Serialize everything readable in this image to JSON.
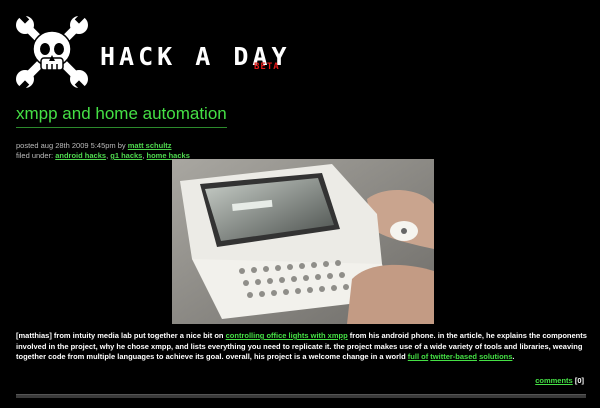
{
  "site": {
    "title": "HACK A DAY",
    "badge": "BETA"
  },
  "post": {
    "title": "xmpp and home automation",
    "posted_prefix": "posted aug 28th 2009 5:45pm by",
    "author": "matt schultz",
    "filed_prefix": "filed under:",
    "categories": [
      "android hacks",
      "g1 hacks",
      "home hacks"
    ],
    "body": {
      "part1": "[matthias] from intuity media lab put together a nice bit on",
      "link1": "controlling office lights with xmpp",
      "part2": "from his android phone. in the article, he explains the components involved in the project, why he chose xmpp, and lists everything you need to replicate it. the project makes use of a wide variety of tools and libraries, weaving together code from multiple languages to achieve its goal. overall, his project is a welcome change in a world",
      "link2": "full of",
      "link3": "twitter-based",
      "link4": "solutions",
      "end": "."
    },
    "comments_label": "comments",
    "comments_count": "[0]",
    "image_alt": "G1 android phone with slide-out keyboard"
  },
  "colors": {
    "accent": "#45e045",
    "badge": "#e21a1a",
    "background": "#000000"
  }
}
